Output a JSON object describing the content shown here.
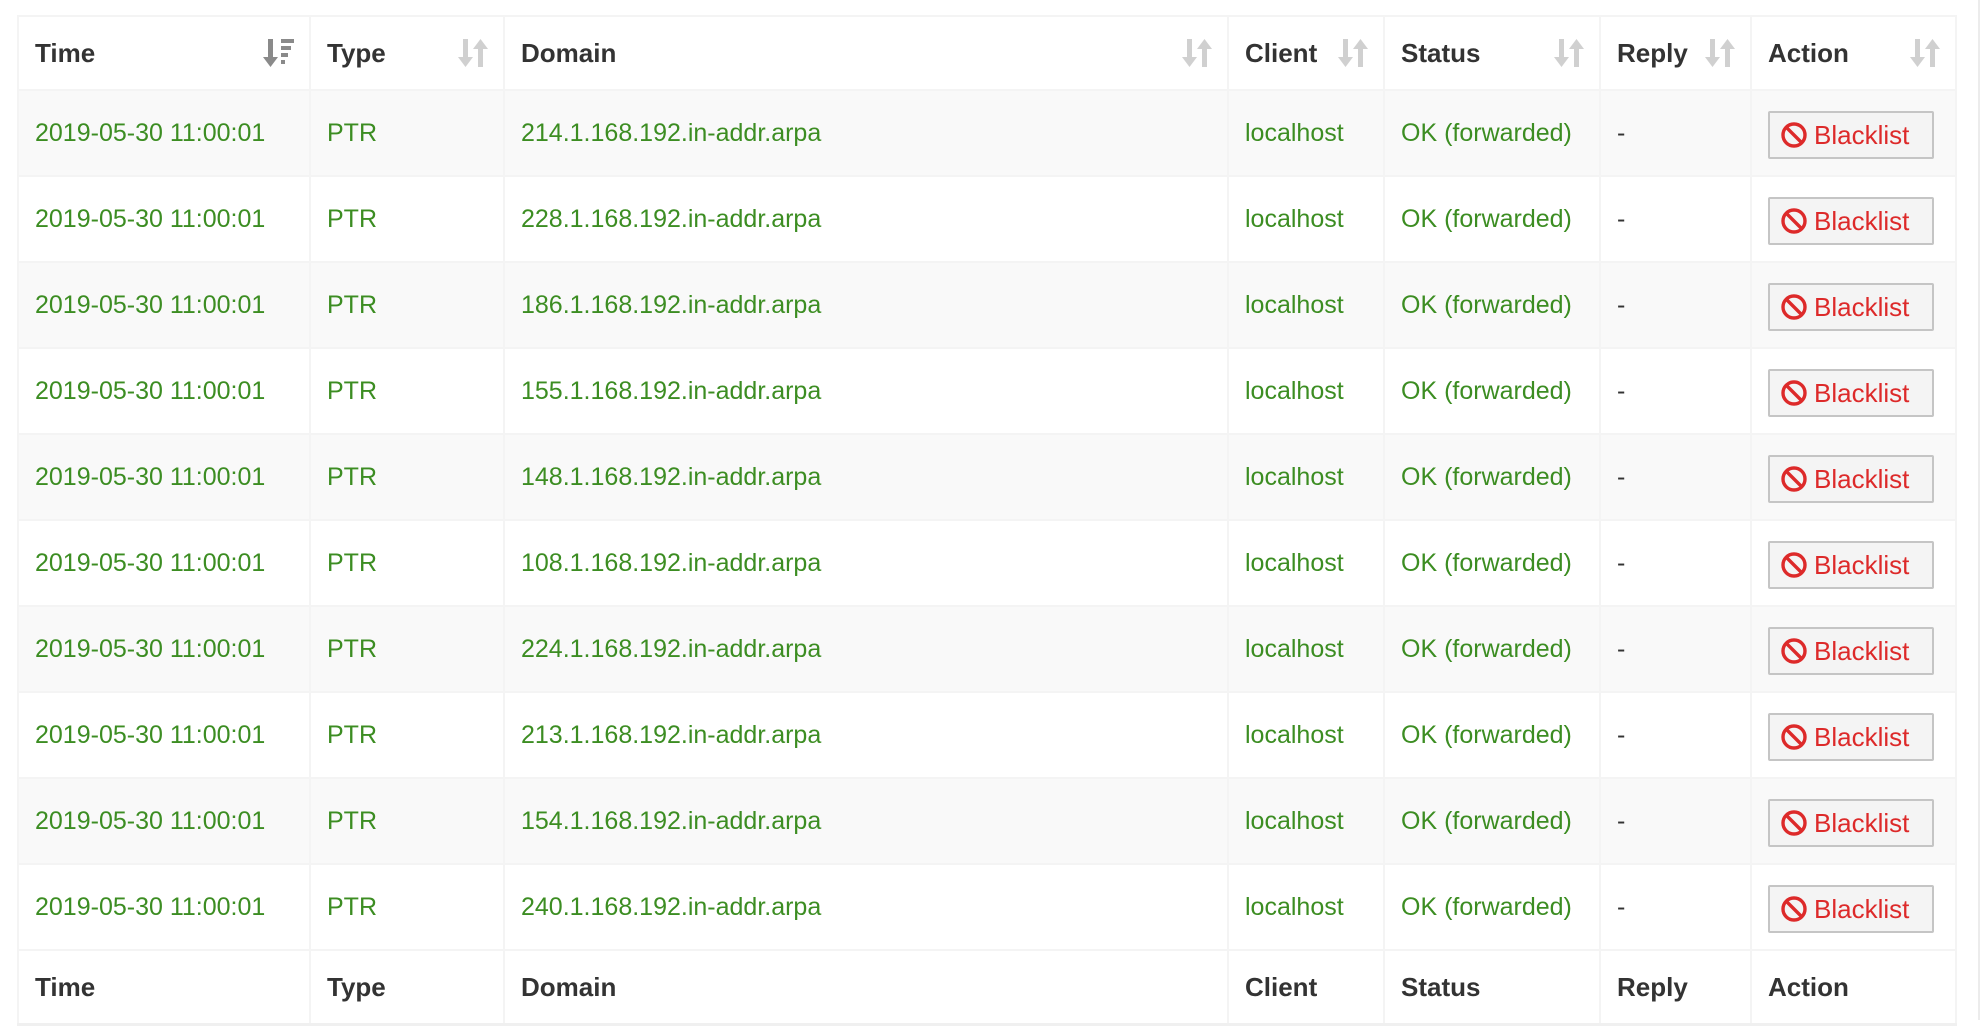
{
  "columns": [
    {
      "key": "time",
      "label": "Time",
      "sort_state": "sorted-desc"
    },
    {
      "key": "type",
      "label": "Type",
      "sort_state": "unsorted"
    },
    {
      "key": "domain",
      "label": "Domain",
      "sort_state": "unsorted"
    },
    {
      "key": "client",
      "label": "Client",
      "sort_state": "unsorted"
    },
    {
      "key": "status",
      "label": "Status",
      "sort_state": "unsorted"
    },
    {
      "key": "reply",
      "label": "Reply",
      "sort_state": "unsorted"
    },
    {
      "key": "action",
      "label": "Action",
      "sort_state": "unsorted"
    }
  ],
  "rows": [
    {
      "time": "2019-05-30 11:00:01",
      "type": "PTR",
      "domain": "214.1.168.192.in-addr.arpa",
      "client": "localhost",
      "status": "OK (forwarded)",
      "reply": "-",
      "action": "Blacklist"
    },
    {
      "time": "2019-05-30 11:00:01",
      "type": "PTR",
      "domain": "228.1.168.192.in-addr.arpa",
      "client": "localhost",
      "status": "OK (forwarded)",
      "reply": "-",
      "action": "Blacklist"
    },
    {
      "time": "2019-05-30 11:00:01",
      "type": "PTR",
      "domain": "186.1.168.192.in-addr.arpa",
      "client": "localhost",
      "status": "OK (forwarded)",
      "reply": "-",
      "action": "Blacklist"
    },
    {
      "time": "2019-05-30 11:00:01",
      "type": "PTR",
      "domain": "155.1.168.192.in-addr.arpa",
      "client": "localhost",
      "status": "OK (forwarded)",
      "reply": "-",
      "action": "Blacklist"
    },
    {
      "time": "2019-05-30 11:00:01",
      "type": "PTR",
      "domain": "148.1.168.192.in-addr.arpa",
      "client": "localhost",
      "status": "OK (forwarded)",
      "reply": "-",
      "action": "Blacklist"
    },
    {
      "time": "2019-05-30 11:00:01",
      "type": "PTR",
      "domain": "108.1.168.192.in-addr.arpa",
      "client": "localhost",
      "status": "OK (forwarded)",
      "reply": "-",
      "action": "Blacklist"
    },
    {
      "time": "2019-05-30 11:00:01",
      "type": "PTR",
      "domain": "224.1.168.192.in-addr.arpa",
      "client": "localhost",
      "status": "OK (forwarded)",
      "reply": "-",
      "action": "Blacklist"
    },
    {
      "time": "2019-05-30 11:00:01",
      "type": "PTR",
      "domain": "213.1.168.192.in-addr.arpa",
      "client": "localhost",
      "status": "OK (forwarded)",
      "reply": "-",
      "action": "Blacklist"
    },
    {
      "time": "2019-05-30 11:00:01",
      "type": "PTR",
      "domain": "154.1.168.192.in-addr.arpa",
      "client": "localhost",
      "status": "OK (forwarded)",
      "reply": "-",
      "action": "Blacklist"
    },
    {
      "time": "2019-05-30 11:00:01",
      "type": "PTR",
      "domain": "240.1.168.192.in-addr.arpa",
      "client": "localhost",
      "status": "OK (forwarded)",
      "reply": "-",
      "action": "Blacklist"
    }
  ],
  "icons": {
    "sort_active": "sort-amount-desc-icon",
    "sort_inactive": "sort-both-icon",
    "action_button": "ban-icon"
  },
  "colors": {
    "row_text": "#3c8d22",
    "header_text": "#333333",
    "blacklist_text": "#dd2a2a",
    "sort_active": "#8a8a8a",
    "sort_inactive": "#d0d0d0",
    "stripe": "#f9f9f9"
  }
}
